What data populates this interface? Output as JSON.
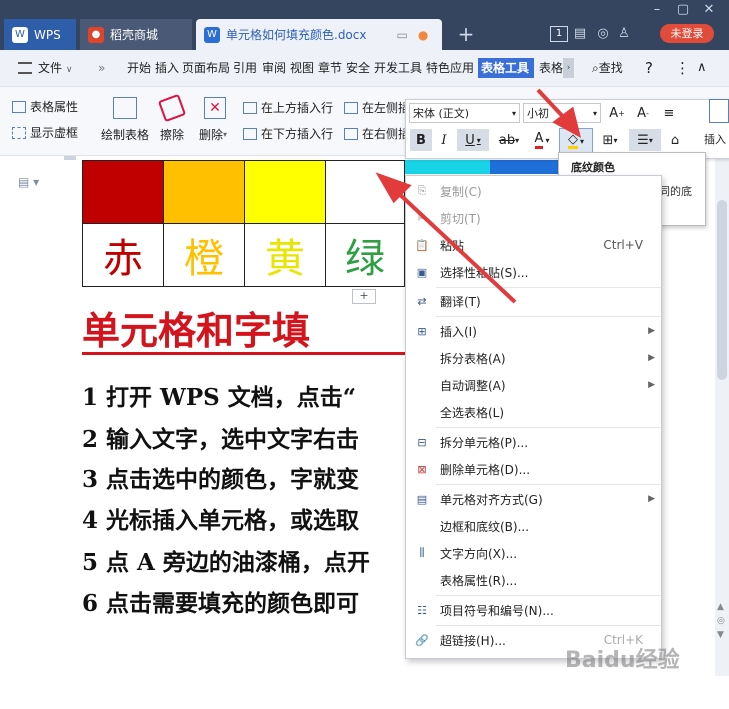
{
  "tabs": [
    {
      "label": "WPS",
      "icon": "wps-logo-icon"
    },
    {
      "label": "稻壳商城",
      "icon": "daoke-icon"
    },
    {
      "label": "单元格如何填充颜色.docx",
      "icon": "doc-icon"
    }
  ],
  "titlebar": {
    "page_count": "1",
    "login_label": "未登录",
    "add_tab": "+"
  },
  "menu": {
    "file": "文件",
    "items": [
      "开始",
      "插入",
      "页面布局",
      "引用",
      "审阅",
      "视图",
      "章节",
      "安全",
      "开发工具",
      "特色应用",
      "表格工具",
      "表格"
    ],
    "active": "表格工具",
    "search": "查找"
  },
  "ribbon": {
    "table_props": "表格属性",
    "show_grid": "显示虚框",
    "draw_table": "绘制表格",
    "erase": "擦除",
    "delete": "删除",
    "insert_above": "在上方插入行",
    "insert_below": "在下方插入行",
    "insert_left": "在左侧插",
    "insert_right": "在右侧插",
    "insert": "插入"
  },
  "format_bar": {
    "font_name": "宋体 (正文)",
    "font_size": "小初",
    "bold": "B",
    "italic": "I",
    "underline": "U"
  },
  "tooltip": {
    "title": "底纹颜色",
    "body": "单击箭头可选择不同的底纹颜色。"
  },
  "document": {
    "color_cells": [
      "#c00000",
      "#ffc000",
      "#ffff00",
      "#ffffff"
    ],
    "chars": [
      {
        "text": "赤",
        "color": "#c00000"
      },
      {
        "text": "橙",
        "color": "#ffc000"
      },
      {
        "text": "黄",
        "color": "#e6e600"
      },
      {
        "text": "绿",
        "color": "#2ea043"
      }
    ],
    "heading": "单元格和字填",
    "steps": [
      "1 打开 WPS 文档，点击“",
      "2 输入文字，选中文字右击",
      "3 点击选中的颜色，字就变",
      "4 光标插入单元格，或选取",
      "5 点 A 旁边的油漆桶，点开",
      "6 点击需要填充的颜色即可"
    ],
    "add_row": "+"
  },
  "context_menu": [
    {
      "label": "复制(C)",
      "icon": "copy-icon",
      "disabled": true
    },
    {
      "label": "剪切(T)",
      "icon": "cut-icon",
      "disabled": true
    },
    {
      "label": "粘贴",
      "icon": "paste-icon",
      "shortcut": "Ctrl+V"
    },
    {
      "label": "选择性粘贴(S)...",
      "icon": "paste-special-icon"
    },
    {
      "label": "翻译(T)",
      "icon": "translate-icon"
    },
    {
      "label": "插入(I)",
      "icon": "table-insert-icon",
      "submenu": true
    },
    {
      "label": "拆分表格(A)",
      "submenu": true
    },
    {
      "label": "自动调整(A)",
      "submenu": true
    },
    {
      "label": "全选表格(L)"
    },
    {
      "label": "拆分单元格(P)...",
      "icon": "split-cells-icon"
    },
    {
      "label": "删除单元格(D)...",
      "icon": "delete-cells-icon"
    },
    {
      "label": "单元格对齐方式(G)",
      "icon": "cell-align-icon",
      "submenu": true
    },
    {
      "label": "边框和底纹(B)..."
    },
    {
      "label": "文字方向(X)...",
      "icon": "text-direction-icon"
    },
    {
      "label": "表格属性(R)..."
    },
    {
      "label": "项目符号和编号(N)...",
      "icon": "bullets-icon"
    },
    {
      "label": "超链接(H)...",
      "icon": "hyperlink-icon",
      "shortcut": "Ctrl+K"
    }
  ],
  "watermark": "Baidu经验",
  "colors": {
    "accent": "#2b5fb8",
    "active_tab": "#3a6fd8",
    "arrow_red": "#e23b3b"
  }
}
